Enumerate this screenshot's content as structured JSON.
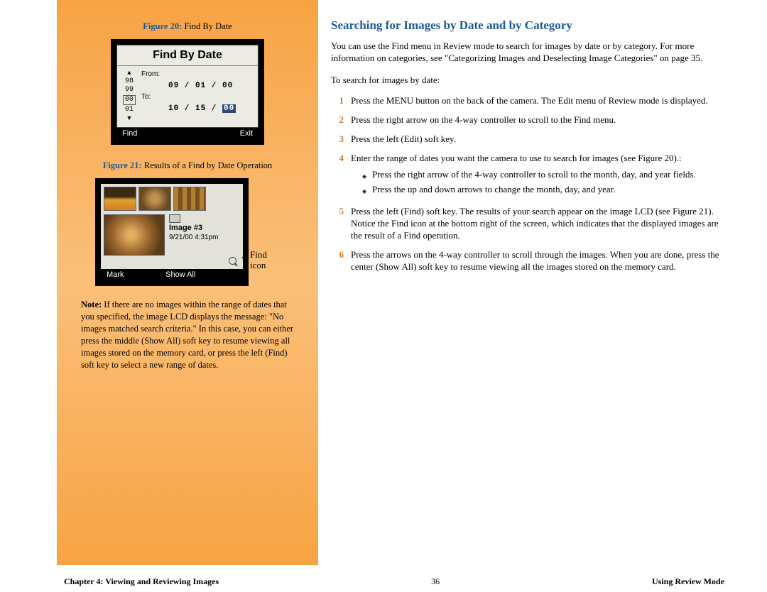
{
  "sidebar": {
    "fig20": {
      "label_prefix": "Figure 20:",
      "label_text": " Find By Date",
      "lcd_title": "Find By Date",
      "scroll_values": [
        "98",
        "99",
        "00",
        "01"
      ],
      "from_label": "From:",
      "from_value": "09 / 01 / 00",
      "to_label": "To:",
      "to_value_prefix": "10 / 15 / ",
      "to_value_hl": "00",
      "softkey_left": "Find",
      "softkey_right": "Exit"
    },
    "fig21": {
      "label_prefix": "Figure 21:",
      "label_text": " Results of a Find by Date Operation",
      "meta_line1": "Image #3",
      "meta_line2": "9/21/00    4:31pm",
      "softkey_left": "Mark",
      "softkey_center": "Show All",
      "arrow_label_line1": "Find",
      "arrow_label_line2": "icon"
    },
    "note_prefix": "Note:",
    "note_body": " If there are no images within the range of dates that you specified, the image LCD displays the message: \"No images matched search criteria.\" In this case, you can either press the middle (Show All) soft key to resume viewing all images stored on the memory card, or press the left (Find) soft key to select a new range of dates."
  },
  "main": {
    "heading": "Searching for Images by Date and by Category",
    "intro": "You can use the Find menu in Review mode to search for images by date or by category. For more information on categories, see \"Categorizing Images and Deselecting Image Categories\" on page 35.",
    "lead": "To search for images by date:",
    "steps": [
      {
        "n": "1",
        "t": "Press the MENU button on the back of the camera. The Edit menu of Review mode is displayed."
      },
      {
        "n": "2",
        "t": "Press the right arrow on the 4-way controller to scroll to the Find menu."
      },
      {
        "n": "3",
        "t": "Press the left (Edit) soft key."
      },
      {
        "n": "4",
        "t": "Enter the range of dates you want the camera to use to search for images (see Figure 20).:",
        "sub": [
          "Press the right arrow of the 4-way controller to scroll to the month, day, and year fields.",
          "Press the up and down arrows to change the month, day, and year."
        ]
      },
      {
        "n": "5",
        "t": "Press the left (Find) soft key. The results of your search appear on the image LCD (see Figure 21). Notice the Find icon at the bottom right of the screen, which indicates that the displayed images are the result of a Find operation."
      },
      {
        "n": "6",
        "t": "Press the arrows on the 4-way controller to scroll through the images. When you are done, press the center (Show All) soft key to resume viewing all the images stored on the memory card."
      }
    ]
  },
  "footer": {
    "left": "Chapter 4: Viewing and Reviewing Images",
    "center": "36",
    "right": "Using Review Mode"
  }
}
